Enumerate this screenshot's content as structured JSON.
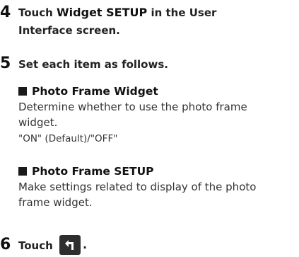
{
  "steps": [
    {
      "number": "4",
      "text_pre": "Touch ",
      "text_key": "Widget SETUP",
      "text_post": " in the User",
      "text_line2": "Interface screen."
    },
    {
      "number": "5",
      "text": "Set each item as follows."
    },
    {
      "number": "6",
      "text": "Touch",
      "period": "."
    }
  ],
  "items": [
    {
      "heading": "Photo Frame Widget",
      "body_lines": [
        "Determine whether to use the photo frame",
        "widget."
      ],
      "note": "\"ON\" (Default)/\"OFF\""
    },
    {
      "heading": "Photo Frame SETUP",
      "body_lines": [
        "Make settings related to display of the photo",
        "frame widget."
      ]
    }
  ],
  "icons": {
    "back_button_icon": "back-arrow-icon"
  },
  "colors": {
    "text": "#2b2b2b",
    "heading": "#111111",
    "button_bg": "#2e2e2e"
  }
}
